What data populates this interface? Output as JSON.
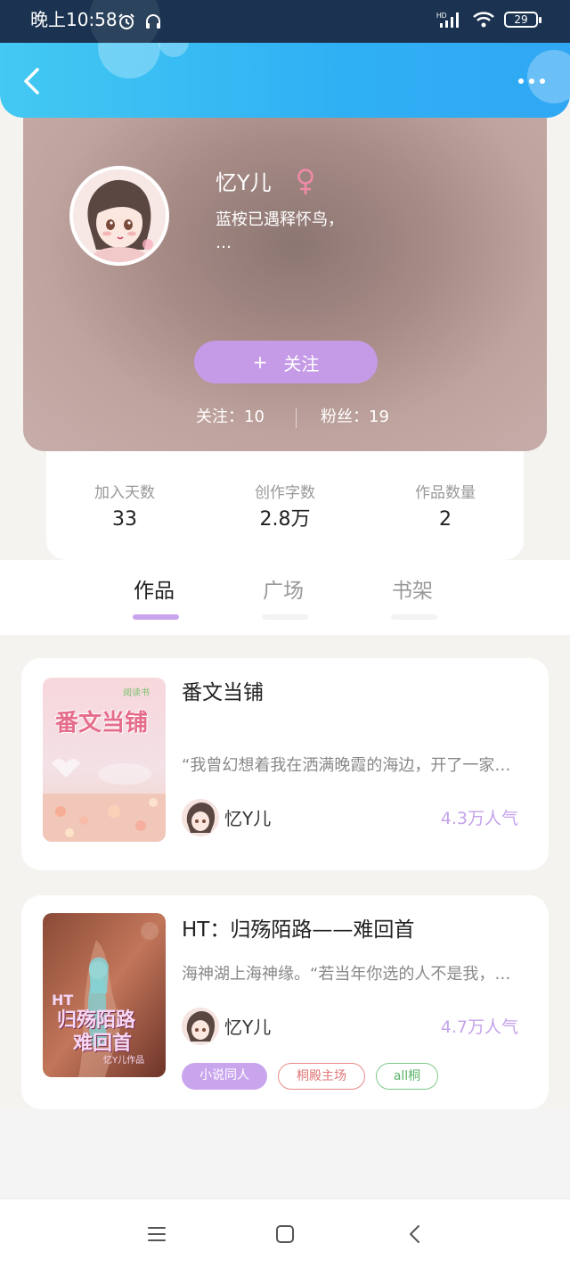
{
  "status_bar": {
    "time": "晚上10:58",
    "battery": "29"
  },
  "profile": {
    "name": "忆Y儿",
    "gender_symbol": "♀",
    "bio_line1": "蓝桉已遇释怀鸟，",
    "bio_line2": "…",
    "follow_button": "关注",
    "follow_plus": "+",
    "following": "关注：10",
    "fans": "粉丝：19"
  },
  "stats": [
    {
      "label": "加入天数",
      "value": "33"
    },
    {
      "label": "创作字数",
      "value": "2.8万"
    },
    {
      "label": "作品数量",
      "value": "2"
    }
  ],
  "tabs": [
    {
      "label": "作品",
      "active": true
    },
    {
      "label": "广场",
      "active": false
    },
    {
      "label": "书架",
      "active": false
    }
  ],
  "works": [
    {
      "title": "番文当铺",
      "excerpt": "“我曾幻想着我在洒满晚霞的海边，开了一家…",
      "author": "忆Y儿",
      "popularity": "4.3万人气",
      "cover_title": "番文当铺",
      "cover_badge": "阅读书"
    },
    {
      "title": "HT：归殇陌路——难回首",
      "excerpt": "海神湖上海神缘。“若当年你选的人不是我，…",
      "author": "忆Y儿",
      "popularity": "4.7万人气",
      "cover_title1": "HT",
      "cover_title2": "归殇陌路",
      "cover_title3": "难回首",
      "cover_sub": "忆Y儿作品",
      "tags": [
        {
          "label": "小说同人",
          "style": "filled-purple"
        },
        {
          "label": "桐殿主场",
          "style": "outline-red"
        },
        {
          "label": "all桐",
          "style": "outline-green"
        }
      ]
    }
  ],
  "colors": {
    "header": "#2fb0f4",
    "accent_purple": "#c59ae6",
    "popularity": "#c4a3ea",
    "tag_red": "#e88a8a",
    "tag_green": "#7fc98a"
  }
}
